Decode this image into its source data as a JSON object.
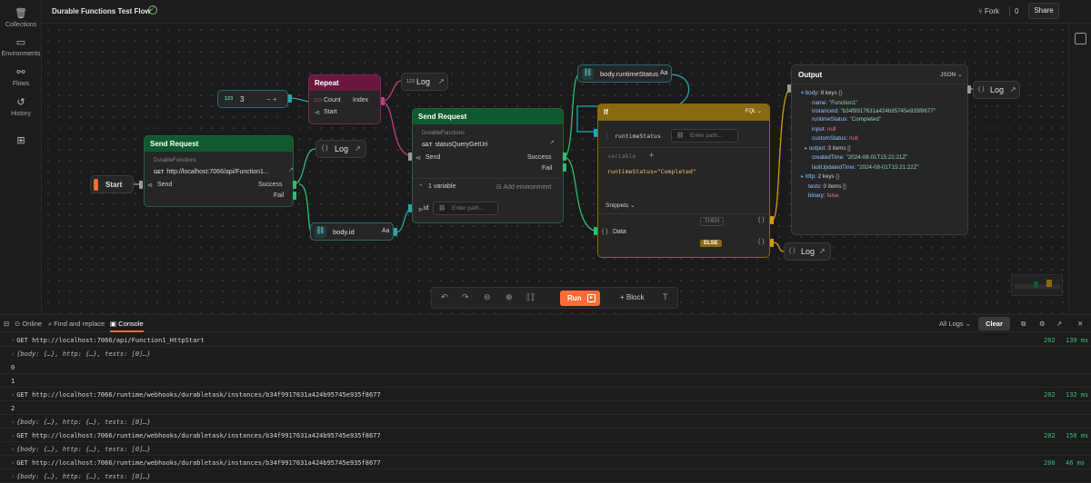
{
  "rail": [
    {
      "label": "Collections",
      "icon": "collections-icon"
    },
    {
      "label": "Environments",
      "icon": "environments-icon"
    },
    {
      "label": "Flows",
      "icon": "flows-icon"
    },
    {
      "label": "History",
      "icon": "history-icon"
    },
    {
      "label": "",
      "icon": "apps-icon"
    }
  ],
  "topbar": {
    "title": "Durable Functions Test Flow",
    "fork_label": "Fork",
    "fork_count": "0",
    "share_label": "Share"
  },
  "nodes": {
    "start": {
      "label": "Start"
    },
    "number": {
      "badge": "123",
      "value": "3",
      "controls": "−  +"
    },
    "repeat": {
      "title": "Repeat",
      "count": "Count",
      "start": "Start",
      "index": "Index",
      "badge": "123"
    },
    "log_top": {
      "badge": "123",
      "label": "Log"
    },
    "send1": {
      "title": "Send Request",
      "collection": "DurableFunctions",
      "method": "GET",
      "url": "http://localhost:7066/api/Function1...",
      "send": "Send",
      "success": "Success",
      "fail": "Fail"
    },
    "log_mid": {
      "label": "Log"
    },
    "send2": {
      "title": "Send Request",
      "collection": "DurableFunctions",
      "method": "GET",
      "url": "statusQueryGetUri",
      "send": "Send",
      "success": "Success",
      "fail": "Fail",
      "vars": "1 variable",
      "add_env": "Add environment",
      "var_name": "id",
      "placeholder": "Enter path..."
    },
    "bodyid": {
      "label": "body.id",
      "suffix": "Aa"
    },
    "runtime": {
      "label": "body.runtimeStatus",
      "suffix": "Aa"
    },
    "if": {
      "title": "If",
      "lang": "FQL",
      "var": "runtimeStatus",
      "placeholder": "Enter path...",
      "add_var": "variable",
      "expr": "runtimeStatus=\"Completed\"",
      "snippets": "Snippets",
      "data": "Data",
      "then": "THEN",
      "else": "ELSE"
    },
    "output": {
      "title": "Output",
      "format": "JSON",
      "body": "body:",
      "body_count": "8 keys",
      "name_k": "name:",
      "name_v": "\"Function1\"",
      "iid_k": "instanceId:",
      "iid_v": "\"b34f9917631a424b95745e935f8677\"",
      "rs_k": "runtimeStatus:",
      "rs_v": "\"Completed\"",
      "in_k": "input:",
      "in_v": "null",
      "cs_k": "customStatus:",
      "cs_v": "null",
      "out_k": "output:",
      "out_v": "3 items",
      "ct_k": "createdTime:",
      "ct_v": "\"2024-08-01T15:21:21Z\"",
      "lu_k": "lastUpdatedTime:",
      "lu_v": "\"2024-08-01T15:21:22Z\"",
      "http_k": "http:",
      "http_v": "2 keys",
      "tests_k": "tests:",
      "tests_v": "0 items",
      "bin_k": "binary:",
      "bin_v": "false"
    },
    "log_out": {
      "label": "Log"
    },
    "log_else": {
      "label": "Log"
    }
  },
  "toolbar": {
    "run": "Run",
    "block": "Block"
  },
  "bottombar": {
    "online": "Online",
    "find": "Find and replace",
    "console": "Console",
    "all_logs": "All Logs",
    "clear": "Clear"
  },
  "console": [
    {
      "text": "GET http://localhost:7066/api/Function1_HttpStart",
      "status": "202",
      "time": "139 ms",
      "kind": "req"
    },
    {
      "text": "{body: {…}, http: {…}, tests: [0]…}",
      "kind": "obj"
    },
    {
      "text": "0",
      "kind": "val"
    },
    {
      "text": "1",
      "kind": "val"
    },
    {
      "text": "GET http://localhost:7066/runtime/webhooks/durabletask/instances/b34f9917631a424b95745e935f8677",
      "status": "202",
      "time": "132 ms",
      "kind": "req"
    },
    {
      "text": "2",
      "kind": "val"
    },
    {
      "text": "{body: {…}, http: {…}, tests: [0]…}",
      "kind": "obj"
    },
    {
      "text": "GET http://localhost:7066/runtime/webhooks/durabletask/instances/b34f9917631a424b95745e935f8677",
      "status": "202",
      "time": "150 ms",
      "kind": "req"
    },
    {
      "text": "{body: {…}, http: {…}, tests: [0]…}",
      "kind": "obj"
    },
    {
      "text": "GET http://localhost:7066/runtime/webhooks/durabletask/instances/b34f9917631a424b95745e935f8677",
      "status": "200",
      "time": "46 ms",
      "kind": "req"
    },
    {
      "text": "{body: {…}, http: {…}, tests: [0]…}",
      "kind": "obj"
    }
  ],
  "colors": {
    "accent": "#ff6c37",
    "success": "#3fbf7a",
    "send_header": "#0f5a2f",
    "repeat_header": "#6b1840",
    "if_header": "#8a6a10"
  }
}
